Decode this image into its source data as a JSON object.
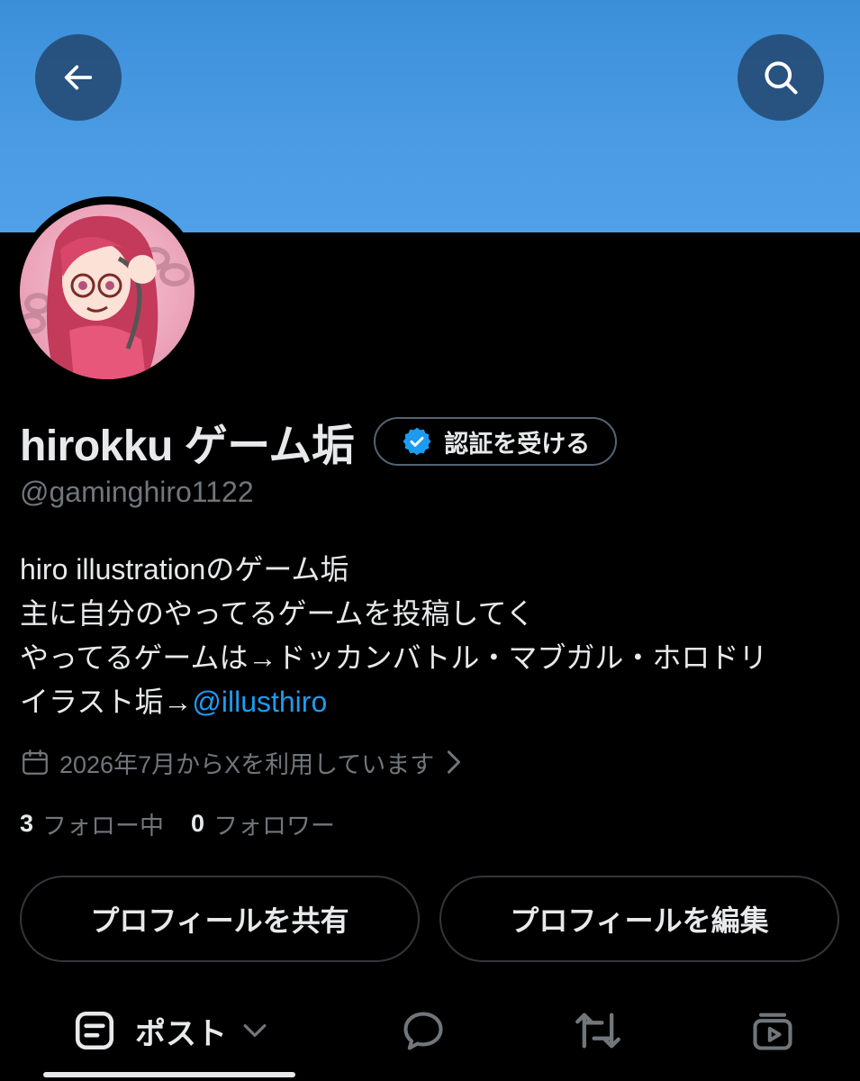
{
  "colors": {
    "banner": "#4a9be3",
    "background": "#000000",
    "text_primary": "#e7e9ea",
    "text_secondary": "#71767b",
    "link": "#1d9bf0",
    "verified_badge": "#1d9bf0"
  },
  "header": {
    "back_icon": "arrow-left-icon",
    "search_icon": "search-icon"
  },
  "profile": {
    "display_name": "hirokku ゲーム垢",
    "verify_button_label": "認証を受ける",
    "handle": "@gaminghiro1122",
    "bio_lines": [
      "hiro illustrationのゲーム垢",
      "主に自分のやってるゲームを投稿してく",
      "やってるゲームは→ドッカンバトル・マブガル・ホロドリ"
    ],
    "bio_last_prefix": "イラスト垢→",
    "bio_mention": "@illusthiro",
    "joined_text": "2026年7月からXを利用しています",
    "following_count": "3",
    "following_label": "フォロー中",
    "followers_count": "0",
    "followers_label": "フォロワー",
    "share_button_label": "プロフィールを共有",
    "edit_button_label": "プロフィールを編集"
  },
  "tabs": {
    "posts_label": "ポスト",
    "posts_icon": "post-list-icon",
    "replies_icon": "reply-bubble-icon",
    "reposts_icon": "repost-icon",
    "media_icon": "media-icon"
  }
}
